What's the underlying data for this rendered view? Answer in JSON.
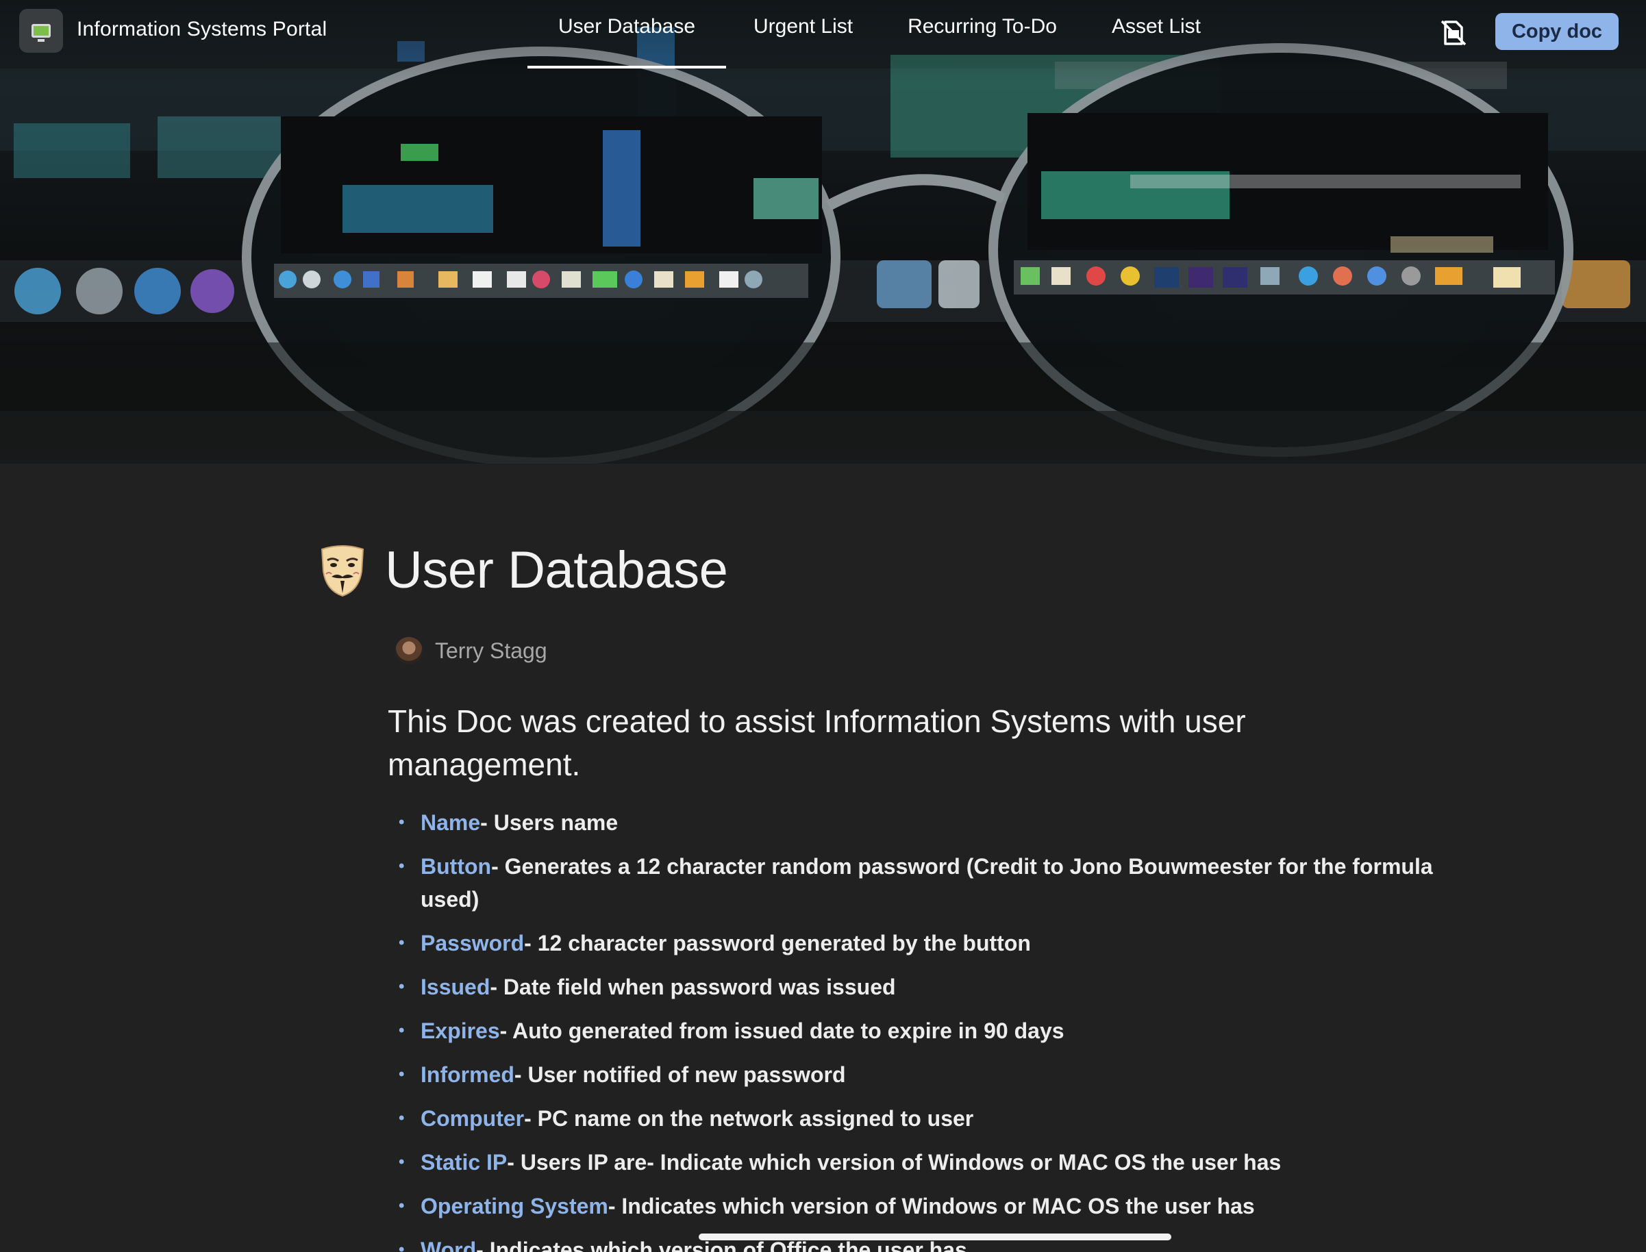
{
  "header": {
    "app_title": "Information Systems Portal",
    "nav_tabs": [
      {
        "label": "User Database"
      },
      {
        "label": "Urgent List"
      },
      {
        "label": "Recurring To-Do"
      },
      {
        "label": "Asset List"
      }
    ],
    "copy_button_label": "Copy doc",
    "icons": {
      "logo": "monitor-icon",
      "print_toggle": "no-print-icon"
    },
    "accent_color": "#8fb4ea"
  },
  "page": {
    "title": "User Database",
    "title_icon": "mask-icon",
    "author": "Terry Stagg",
    "intro": "This Doc was created to assist Information Systems with user management.",
    "fields": [
      {
        "term": "Name",
        "desc": "- Users name"
      },
      {
        "term": "Button",
        "desc": "- Generates a 12 character random password (Credit to Jono Bouwmeester for the formula used)"
      },
      {
        "term": "Password",
        "desc": "- 12 character password generated by the button"
      },
      {
        "term": "Issued",
        "desc": "- Date field when password was issued"
      },
      {
        "term": "Expires",
        "desc": "- Auto generated from issued date to expire in 90 days"
      },
      {
        "term": "Informed",
        "desc": "- User notified of new password"
      },
      {
        "term": "Computer",
        "desc": "- PC name on the network assigned to user"
      },
      {
        "term": "Static IP",
        "desc": "- Users IP are- Indicate which version of Windows or MAC OS the user has"
      },
      {
        "term": "Operating System",
        "desc": "- Indicates which version of Windows or MAC OS the user has"
      },
      {
        "term": "Word",
        "desc": "- Indicates which version of Office the user has"
      }
    ]
  }
}
